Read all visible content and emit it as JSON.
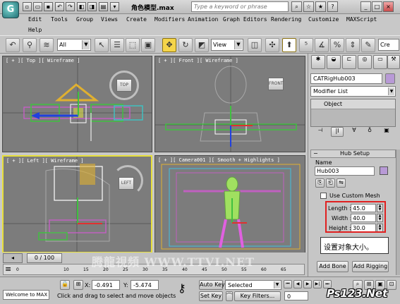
{
  "window": {
    "title": "角色模型.max",
    "search_placeholder": "Type a keyword or phrase",
    "app_logo": "G"
  },
  "menu": {
    "items": [
      "Edit",
      "Tools",
      "Group",
      "Views",
      "Create",
      "Modifiers",
      "Animation",
      "Graph Editors",
      "Rendering",
      "Customize",
      "MAXScript"
    ],
    "help": "Help"
  },
  "toolbar": {
    "selection_filter": "All",
    "reference_coord": "View",
    "create_selection_set": "Cre"
  },
  "viewports": {
    "top": {
      "label": "[ + ][ Top ][ Wireframe ]",
      "cube_label": "TOP"
    },
    "front": {
      "label": "[ + ][ Front ][ Wireframe ]"
    },
    "left": {
      "label": "[ + ][ Left ][ Wireframe ]",
      "cube_label": "LEFT"
    },
    "camera": {
      "label": "[ + ][ Camera001 ][ Smooth + Highlights ]"
    }
  },
  "command_panel": {
    "object_name": "CATRigHub003",
    "modifier_list": "Modifier List",
    "stack_item": "Object",
    "rollout_title": "Hub Setup",
    "name_label": "Name",
    "name_value": "Hub003",
    "use_custom_mesh_label": "Use Custom Mesh",
    "length_label": "Length :",
    "length_value": "45.0",
    "width_label": "Width :",
    "width_value": "40.0",
    "height_label": "Height :",
    "height_value": "30.0",
    "add_bone_label": "Add Bone",
    "add_rigging_label": "Add Rigging",
    "object_color": "#b89ad6"
  },
  "annotation": {
    "callout_text": "设置对象大小。",
    "highlight_color": "#e02020"
  },
  "timeline": {
    "frame_display": "0 / 100",
    "ticks": [
      "0",
      "10",
      "15",
      "20",
      "25",
      "30",
      "35",
      "40",
      "45",
      "50",
      "55",
      "60",
      "65",
      "70",
      "75",
      "80",
      "85",
      "90"
    ]
  },
  "statusbar": {
    "maxscript_listener": "Welcome to MAX",
    "x_label": "X:",
    "x_value": "-0.491",
    "y_label": "Y:",
    "y_value": "-5.474",
    "prompt_text": "Click and drag to select and move objects",
    "auto_key_label": "Auto Key",
    "set_key_label": "Set Key",
    "key_mode": "Selected",
    "key_filters_label": "Key Filters...",
    "current_frame": "0"
  },
  "watermark": {
    "text": "腾龍視頻 WWW.TTVI.NET",
    "site_logo": "Ps123.Net"
  }
}
